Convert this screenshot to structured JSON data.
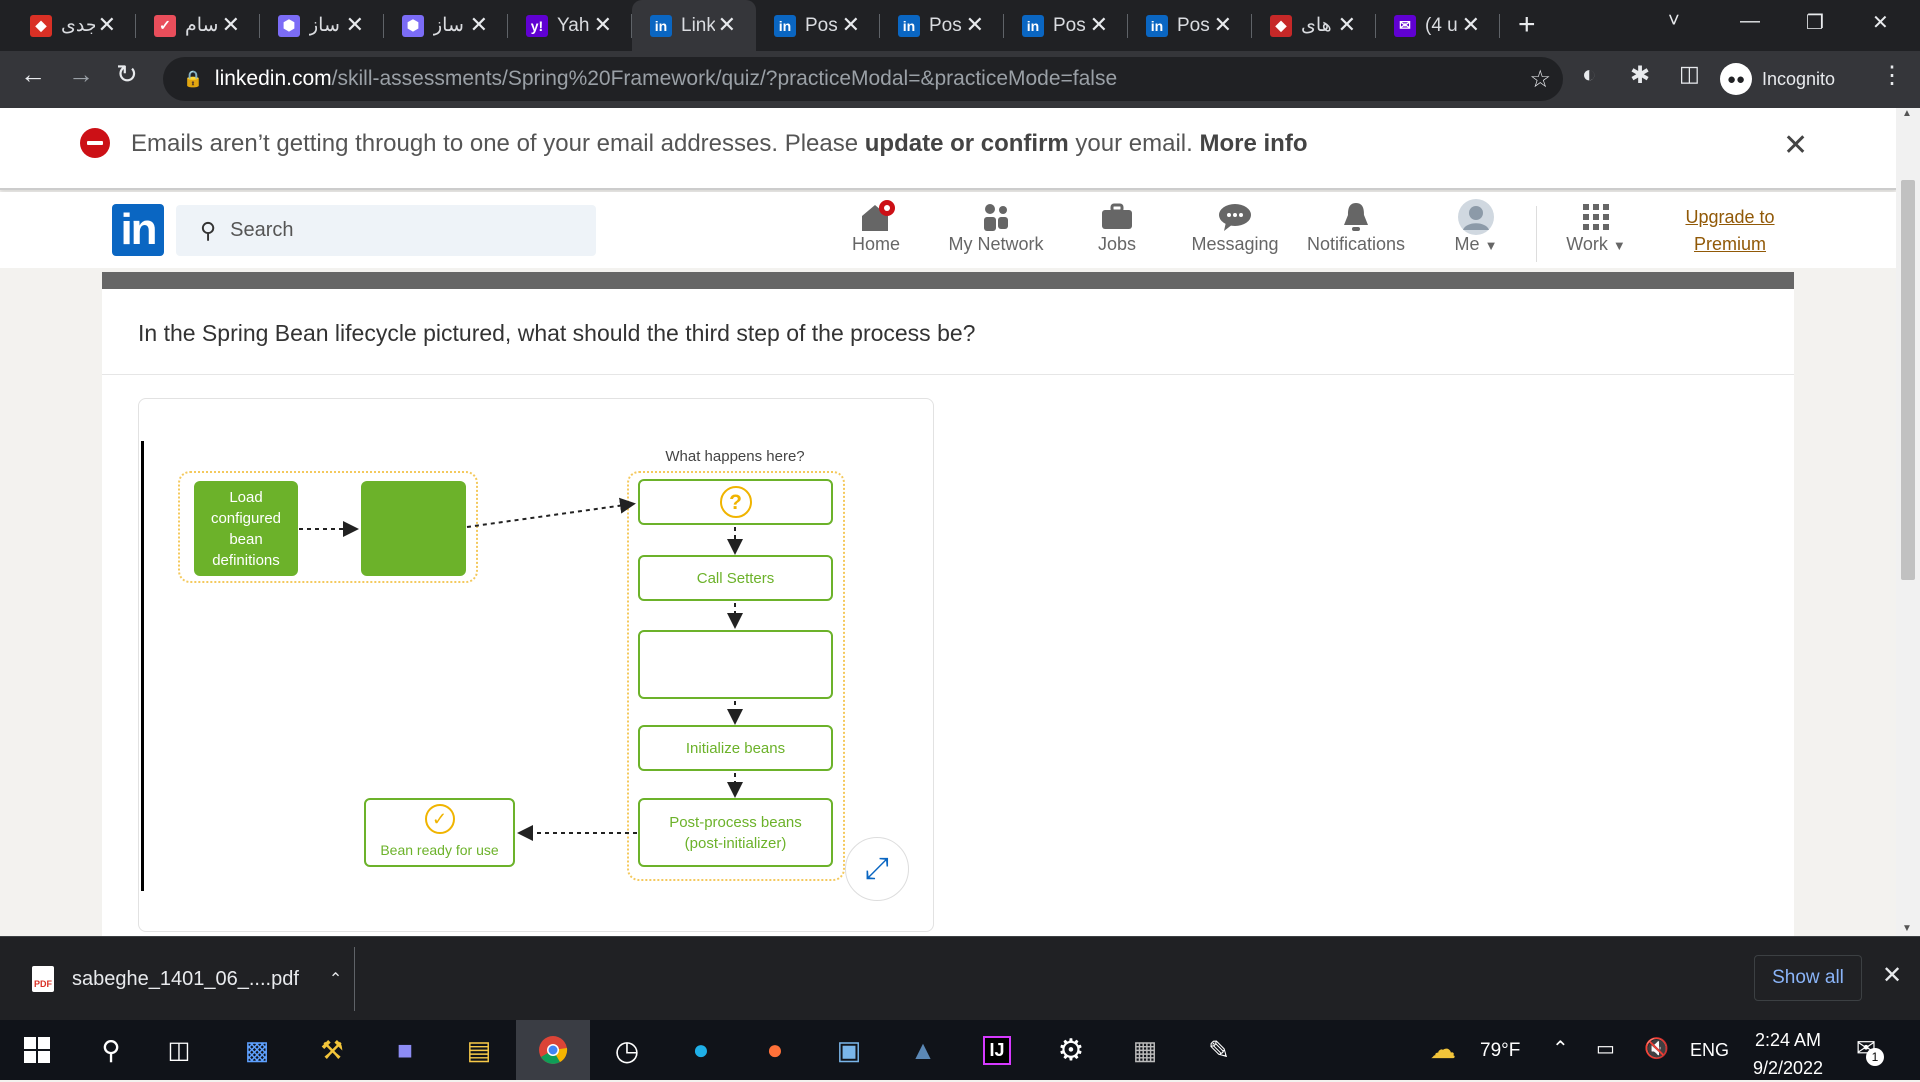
{
  "browser": {
    "tabs": [
      {
        "title": "جدی",
        "icon": "red-arrow-icon",
        "color": "#d93025"
      },
      {
        "title": "سام",
        "icon": "check-icon",
        "color": "#e94e5b"
      },
      {
        "title": "ساز",
        "icon": "hexagon-icon",
        "color": "#7b6cf6"
      },
      {
        "title": "ساز",
        "icon": "hexagon-icon",
        "color": "#7b6cf6"
      },
      {
        "title": "Yah",
        "icon": "yahoo-icon",
        "color": "#6001d2"
      },
      {
        "title": "Link",
        "icon": "linkedin-icon",
        "color": "#0a66c2",
        "active": true
      },
      {
        "title": "Pos",
        "icon": "linkedin-icon",
        "color": "#0a66c2"
      },
      {
        "title": "Pos",
        "icon": "linkedin-icon",
        "color": "#0a66c2"
      },
      {
        "title": "Pos",
        "icon": "linkedin-icon",
        "color": "#0a66c2"
      },
      {
        "title": "Pos",
        "icon": "linkedin-icon",
        "color": "#0a66c2"
      },
      {
        "title": "های",
        "icon": "red-logo-icon",
        "color": "#c62828"
      },
      {
        "title": "(4 u",
        "icon": "yahoo-mail-icon",
        "color": "#6001d2"
      }
    ],
    "url_domain": "linkedin.com",
    "url_path": "/skill-assessments/Spring%20Framework/quiz/?practiceModal=&practiceMode=false",
    "profile_label": "Incognito"
  },
  "banner": {
    "text_before": "Emails aren’t getting through to one of your email addresses. Please ",
    "link_text": "update or confirm",
    "text_after": " your email.",
    "more_info": "More info"
  },
  "linkedin": {
    "search_placeholder": "Search",
    "nav": {
      "home": "Home",
      "network": "My Network",
      "jobs": "Jobs",
      "messaging": "Messaging",
      "notifications": "Notifications",
      "me": "Me",
      "work": "Work",
      "upgrade_line1": "Upgrade to",
      "upgrade_line2": "Premium"
    }
  },
  "question": {
    "text": "In the Spring Bean lifecycle pictured, what should the third step of the process be?"
  },
  "diagram": {
    "load_box": "Load configured bean definitions",
    "what_happens": "What happens here?",
    "question_mark": "?",
    "call_setters": "Call Setters",
    "initialize_beans": "Initialize beans",
    "post_process": "Post-process beans (post-initializer)",
    "bean_ready": "Bean ready for use",
    "accent_green": "#6cb22a",
    "accent_yellow": "#f4c95d"
  },
  "downloads": {
    "file_name": "sabeghe_1401_06_....pdf",
    "show_all": "Show all"
  },
  "taskbar": {
    "weather": "79°F",
    "language": "ENG",
    "time": "2:24 AM",
    "date": "9/2/2022",
    "notification_count": "1"
  }
}
